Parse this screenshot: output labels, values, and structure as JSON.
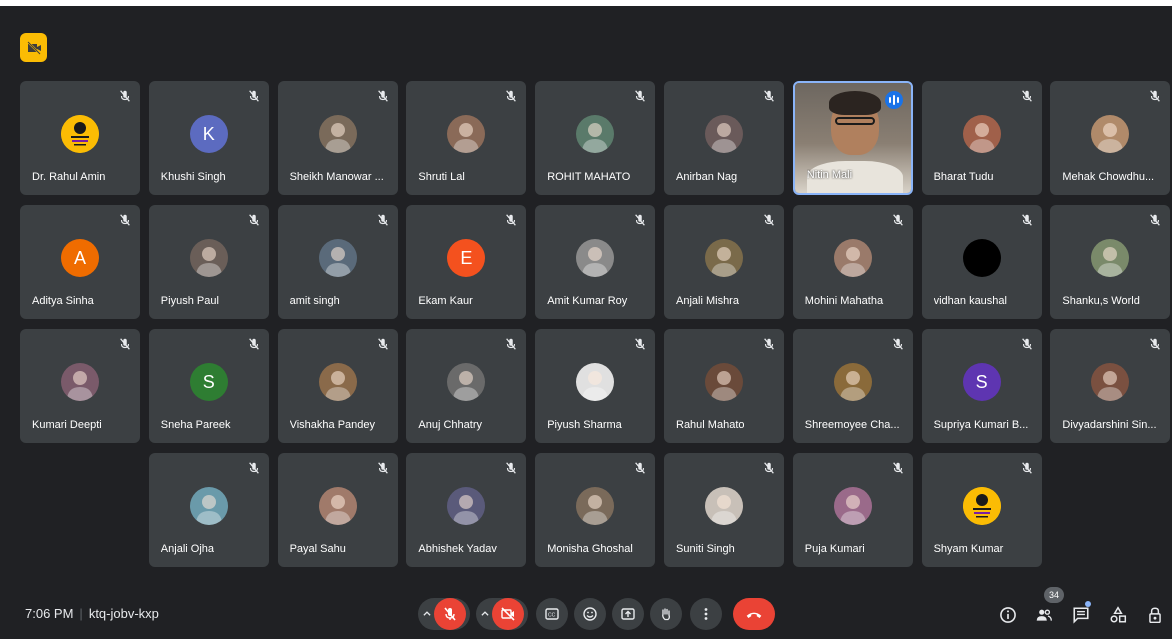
{
  "meeting": {
    "time": "7:06 PM",
    "code": "ktq-jobv-kxp",
    "participant_count": "34"
  },
  "colors": {
    "background": "#202124",
    "tile": "#3c4043",
    "accent_blue": "#8ab4f8",
    "end_call_red": "#ea4335",
    "badge_yellow": "#fbbc04"
  },
  "participants": [
    {
      "name": "Dr. Rahul Amin",
      "avatar": "logo",
      "color": "#fbbc04",
      "initial": ""
    },
    {
      "name": "Khushi Singh",
      "avatar": "initial",
      "color": "#5c6bc0",
      "initial": "K"
    },
    {
      "name": "Sheikh Manowar ...",
      "avatar": "photo",
      "color": "#7a6a5a",
      "initial": ""
    },
    {
      "name": "Shruti Lal",
      "avatar": "photo",
      "color": "#8a6a58",
      "initial": ""
    },
    {
      "name": "ROHIT MAHATO",
      "avatar": "photo",
      "color": "#5a7a6a",
      "initial": ""
    },
    {
      "name": "Anirban Nag",
      "avatar": "photo",
      "color": "#6a5a5a",
      "initial": ""
    },
    {
      "name": "Nitin Mali",
      "avatar": "video",
      "color": "#8a7f73",
      "initial": ""
    },
    {
      "name": "Bharat Tudu",
      "avatar": "photo",
      "color": "#a0604a",
      "initial": ""
    },
    {
      "name": "Mehak Chowdhu...",
      "avatar": "photo",
      "color": "#b08a6a",
      "initial": ""
    },
    {
      "name": "Aditya Sinha",
      "avatar": "initial",
      "color": "#ef6c00",
      "initial": "A"
    },
    {
      "name": "Piyush Paul",
      "avatar": "photo",
      "color": "#6a5e58",
      "initial": ""
    },
    {
      "name": "amit singh",
      "avatar": "photo",
      "color": "#5a6a7a",
      "initial": ""
    },
    {
      "name": "Ekam Kaur",
      "avatar": "initial",
      "color": "#f4511e",
      "initial": "E"
    },
    {
      "name": "Amit Kumar Roy",
      "avatar": "photo",
      "color": "#8a8a8a",
      "initial": ""
    },
    {
      "name": "Anjali Mishra",
      "avatar": "photo",
      "color": "#7a6a4a",
      "initial": ""
    },
    {
      "name": "Mohini Mahatha",
      "avatar": "photo",
      "color": "#9a7a6a",
      "initial": ""
    },
    {
      "name": "vidhan kaushal",
      "avatar": "photo",
      "color": "#000000",
      "initial": ""
    },
    {
      "name": "Shanku,s World",
      "avatar": "photo",
      "color": "#7a8a6a",
      "initial": ""
    },
    {
      "name": "Kumari Deepti",
      "avatar": "photo",
      "color": "#7a5a6a",
      "initial": ""
    },
    {
      "name": "Sneha Pareek",
      "avatar": "initial",
      "color": "#2e7d32",
      "initial": "S"
    },
    {
      "name": "Vishakha Pandey",
      "avatar": "photo",
      "color": "#8a6a4a",
      "initial": ""
    },
    {
      "name": "Anuj Chhatry",
      "avatar": "photo",
      "color": "#6a6a6a",
      "initial": ""
    },
    {
      "name": "Piyush Sharma",
      "avatar": "photo",
      "color": "#e0e0e0",
      "initial": ""
    },
    {
      "name": "Rahul Mahato",
      "avatar": "photo",
      "color": "#6a4a3a",
      "initial": ""
    },
    {
      "name": "Shreemoyee Cha...",
      "avatar": "photo",
      "color": "#8a6a3a",
      "initial": ""
    },
    {
      "name": "Supriya Kumari B...",
      "avatar": "initial",
      "color": "#5e35b1",
      "initial": "S"
    },
    {
      "name": "Divyadarshini Sin...",
      "avatar": "photo",
      "color": "#7a5040",
      "initial": ""
    },
    {
      "name": "Anjali Ojha",
      "avatar": "photo",
      "color": "#6a9aaa",
      "initial": ""
    },
    {
      "name": "Payal Sahu",
      "avatar": "photo",
      "color": "#a07a6a",
      "initial": ""
    },
    {
      "name": "Abhishek Yadav",
      "avatar": "photo",
      "color": "#5a5a7a",
      "initial": ""
    },
    {
      "name": "Monisha Ghoshal",
      "avatar": "photo",
      "color": "#7a6a5a",
      "initial": ""
    },
    {
      "name": "Suniti Singh",
      "avatar": "photo",
      "color": "#c8c0b8",
      "initial": ""
    },
    {
      "name": "Puja Kumari",
      "avatar": "photo",
      "color": "#9a6a8a",
      "initial": ""
    },
    {
      "name": "Shyam Kumar",
      "avatar": "logo",
      "color": "#fbbc04",
      "initial": ""
    }
  ],
  "controls": {
    "left": [
      {
        "name": "mic-toggle",
        "icon": "mic-off-icon",
        "state": "off"
      },
      {
        "name": "camera-toggle",
        "icon": "camera-off-icon",
        "state": "off"
      },
      {
        "name": "captions-button",
        "icon": "captions-icon"
      },
      {
        "name": "reactions-button",
        "icon": "emoji-icon"
      },
      {
        "name": "present-button",
        "icon": "present-icon"
      },
      {
        "name": "raise-hand-button",
        "icon": "hand-icon"
      },
      {
        "name": "more-options-button",
        "icon": "more-vert-icon"
      },
      {
        "name": "leave-call-button",
        "icon": "end-call-icon"
      }
    ],
    "right": [
      {
        "name": "meeting-details-button",
        "icon": "info-icon"
      },
      {
        "name": "people-button",
        "icon": "people-icon"
      },
      {
        "name": "chat-button",
        "icon": "chat-icon"
      },
      {
        "name": "activities-button",
        "icon": "activities-icon"
      },
      {
        "name": "host-controls-button",
        "icon": "lock-person-icon"
      }
    ]
  }
}
